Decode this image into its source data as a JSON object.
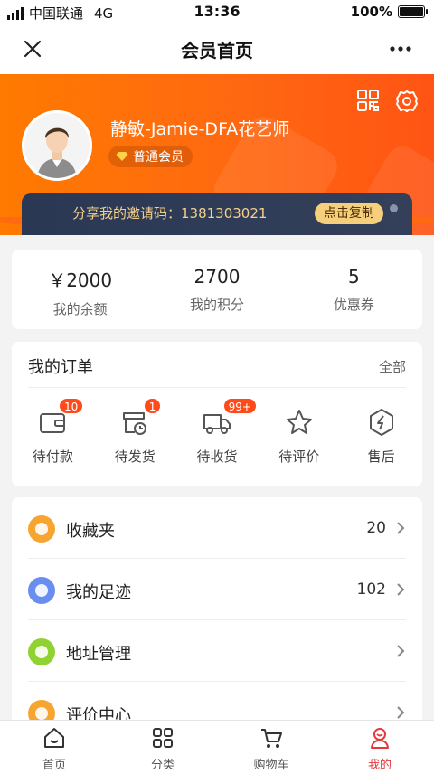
{
  "status_bar": {
    "carrier": "中国联通",
    "network": "4G",
    "time": "13:36",
    "battery": "100%"
  },
  "nav": {
    "title": "会员首页",
    "close_icon": "close-icon",
    "more_icon": "more-icon"
  },
  "profile": {
    "username": "静敏-Jamie-DFA花艺师",
    "level": "普通会员",
    "invite_text": "分享我的邀请码：1381303021",
    "copy_label": "点击复制"
  },
  "stats": [
    {
      "value": "￥2000",
      "label": "我的余额"
    },
    {
      "value": "2700",
      "label": "我的积分"
    },
    {
      "value": "5",
      "label": "优惠券"
    }
  ],
  "orders": {
    "title": "我的订单",
    "all_label": "全部",
    "items": [
      {
        "label": "待付款",
        "badge": "10",
        "icon": "wallet-icon"
      },
      {
        "label": "待发货",
        "badge": "1",
        "icon": "pending-shipment-icon"
      },
      {
        "label": "待收货",
        "badge": "99+",
        "icon": "delivery-truck-icon"
      },
      {
        "label": "待评价",
        "badge": "",
        "icon": "star-icon"
      },
      {
        "label": "售后",
        "badge": "",
        "icon": "after-sales-icon"
      }
    ]
  },
  "menu": [
    {
      "label": "收藏夹",
      "value": "20",
      "icon": "favorites-icon",
      "color": "#f7a531"
    },
    {
      "label": "我的足迹",
      "value": "102",
      "icon": "footprint-icon",
      "color": "#6a8df0"
    },
    {
      "label": "地址管理",
      "value": "",
      "icon": "location-icon",
      "color": "#8fd232"
    },
    {
      "label": "评价中心",
      "value": "",
      "icon": "review-icon",
      "color": "#f7a531"
    }
  ],
  "tabbar": [
    {
      "label": "首页",
      "icon": "home-icon"
    },
    {
      "label": "分类",
      "icon": "category-icon"
    },
    {
      "label": "购物车",
      "icon": "cart-icon"
    },
    {
      "label": "我的",
      "icon": "profile-icon"
    }
  ],
  "colors": {
    "brand": "#ff6a10",
    "accent_red": "#e8383d",
    "badge": "#ff4a1a",
    "invite_bg": "#2a3854",
    "invite_text": "#f6d08a"
  }
}
